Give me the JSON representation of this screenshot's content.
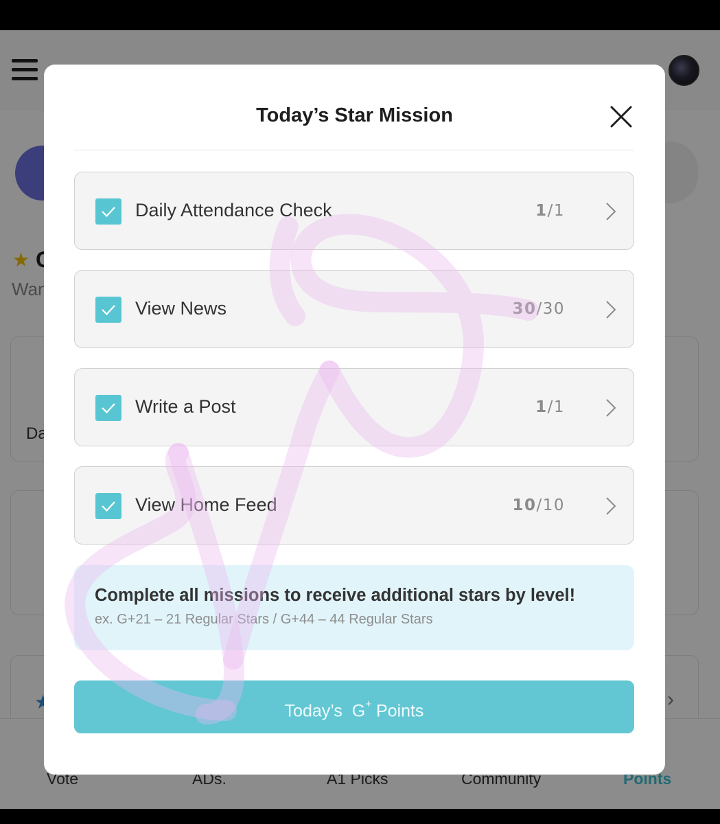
{
  "app": {
    "avatar_alt": "profile"
  },
  "background": {
    "partial_heading": "C",
    "partial_sub": "Wan",
    "partial_card_text": "Da"
  },
  "bottom_nav": {
    "items": [
      {
        "label": "Vote",
        "active": false
      },
      {
        "label": "ADs.",
        "active": false
      },
      {
        "label": "A1 Picks",
        "active": false
      },
      {
        "label": "Community",
        "active": false
      },
      {
        "label": "Points",
        "active": true
      }
    ]
  },
  "modal": {
    "title": "Today’s Star Mission",
    "missions": [
      {
        "label": "Daily Attendance Check",
        "done": "1",
        "total": "/1",
        "checked": true
      },
      {
        "label": "View News",
        "done": "30",
        "total": "/30",
        "checked": true
      },
      {
        "label": "Write a Post",
        "done": "1",
        "total": "/1",
        "checked": true
      },
      {
        "label": "View Home Feed",
        "done": "10",
        "total": "/10",
        "checked": true
      }
    ],
    "info": {
      "title": "Complete all missions to receive additional stars by level!",
      "subtitle": "ex. G+21 – 21 Regular Stars / G+44 – 44 Regular Stars"
    },
    "points_button": {
      "prefix": "Today’s",
      "brand": "G",
      "brand_sup": "+",
      "suffix": "Points"
    }
  },
  "colors": {
    "accent": "#62c7d3",
    "checkbox": "#58c6d2",
    "info_bg": "#e1f4f9",
    "nav_active": "#3fc1cf"
  }
}
